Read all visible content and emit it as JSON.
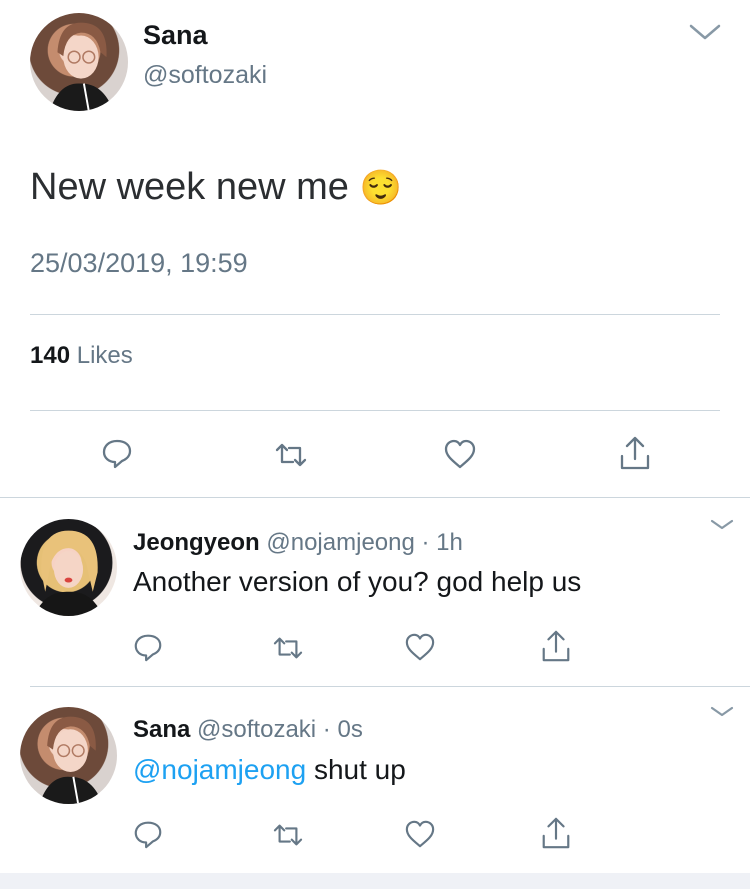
{
  "main_tweet": {
    "display_name": "Sana",
    "handle": "@softozaki",
    "text": "New week new me",
    "emoji": "😌",
    "timestamp": "25/03/2019, 19:59",
    "likes_count": "140",
    "likes_label": "Likes"
  },
  "replies": [
    {
      "display_name": "Jeongyeon",
      "handle": "@nojamjeong",
      "dot": "·",
      "time": "1h",
      "text": "Another version of you? god help us",
      "mention": ""
    },
    {
      "display_name": "Sana",
      "handle": "@softozaki",
      "dot": "·",
      "time": "0s",
      "mention": "@nojamjeong",
      "text": " shut up"
    }
  ],
  "icons": {
    "reply": "reply-icon",
    "retweet": "retweet-icon",
    "like": "heart-icon",
    "share": "share-icon",
    "menu": "chevron-down-icon"
  },
  "colors": {
    "text": "#14171a",
    "muted": "#657786",
    "link": "#1da1f2",
    "divider": "#ccd6dd"
  }
}
